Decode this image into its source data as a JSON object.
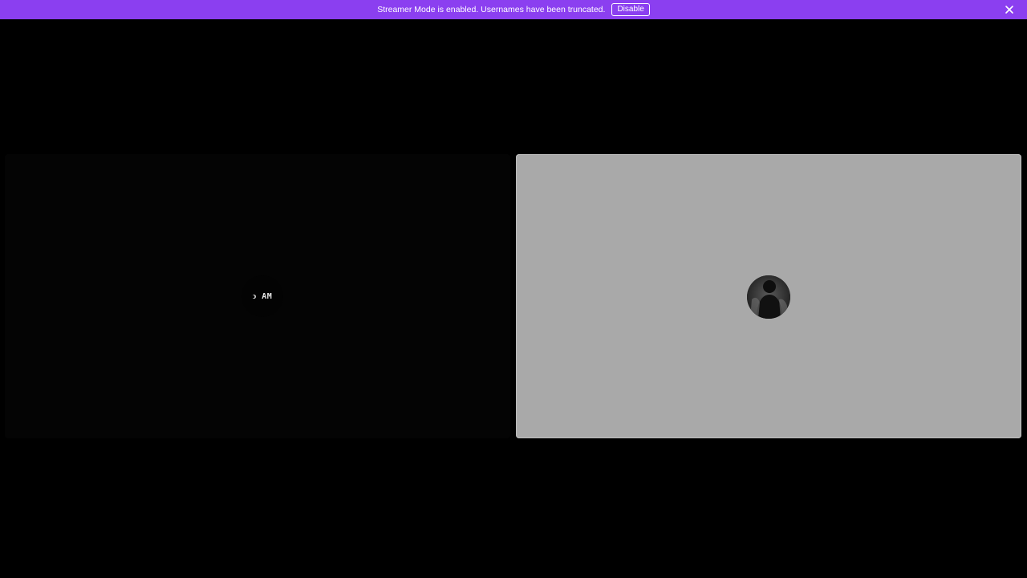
{
  "banner": {
    "message": "Streamer Mode is enabled. Usernames have been truncated.",
    "disable_label": "Disable",
    "close_icon": "close-icon",
    "color": "#8b3ff0"
  },
  "tiles": {
    "left": {
      "avatar_text": "ↄ AM",
      "background": "#040404"
    },
    "right": {
      "avatar_icon": "user-avatar-photo",
      "background": "#a9a9a9"
    }
  }
}
